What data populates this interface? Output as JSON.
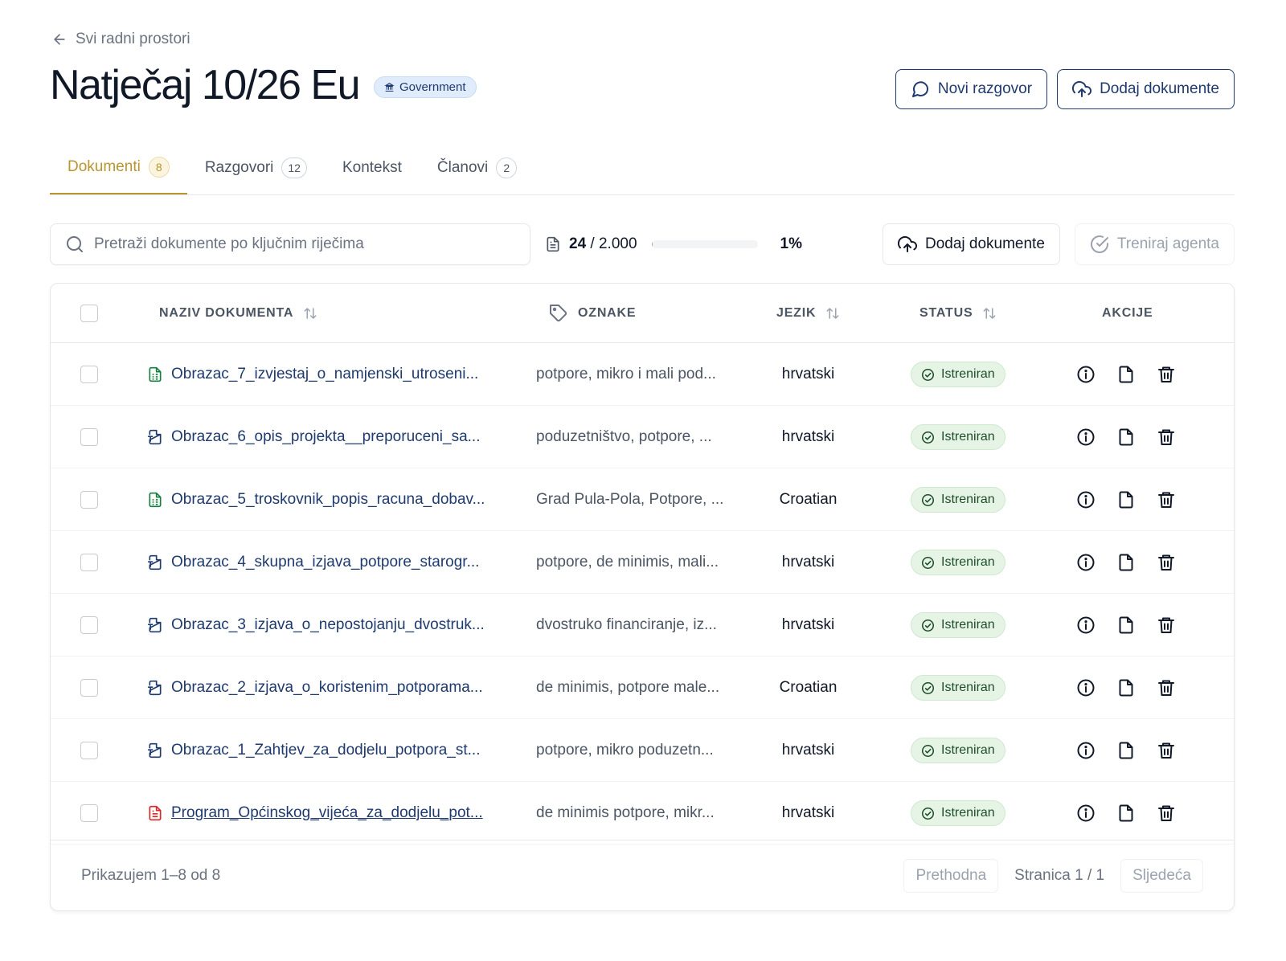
{
  "back_link": "Svi radni prostori",
  "title": "Natječaj 10/26 Eu",
  "category_badge": "Government",
  "header_buttons": {
    "new_chat": "Novi razgovor",
    "add_docs": "Dodaj dokumente"
  },
  "tabs": [
    {
      "label": "Dokumenti",
      "count": "8",
      "active": true
    },
    {
      "label": "Razgovori",
      "count": "12"
    },
    {
      "label": "Kontekst",
      "count": null
    },
    {
      "label": "Članovi",
      "count": "2"
    }
  ],
  "search": {
    "placeholder": "Pretraži dokumente po ključnim riječima"
  },
  "quota": {
    "used": "24",
    "limit": "2.000",
    "percent": "1%",
    "fill_fraction": 0.012
  },
  "toolbar": {
    "add_docs": "Dodaj dokumente",
    "train_agent": "Treniraj agenta"
  },
  "table": {
    "columns": {
      "name": "NAZIV DOKUMENTA",
      "tags": "OZNAKE",
      "language": "JEZIK",
      "status": "STATUS",
      "actions": "AKCIJE"
    },
    "rows": [
      {
        "name": "Obrazac_7_izvjestaj_o_namjenski_utroseni...",
        "type": "sheet",
        "tags": "potpore, mikro i mali pod...",
        "language": "hrvatski",
        "status": "Istreniran"
      },
      {
        "name": "Obrazac_6_opis_projekta__preporuceni_sa...",
        "type": "doc",
        "tags": "poduzetništvo, potpore, ...",
        "language": "hrvatski",
        "status": "Istreniran"
      },
      {
        "name": "Obrazac_5_troskovnik_popis_racuna_dobav...",
        "type": "sheet",
        "tags": "Grad Pula-Pola, Potpore, ...",
        "language": "Croatian",
        "status": "Istreniran"
      },
      {
        "name": "Obrazac_4_skupna_izjava_potpore_starogr...",
        "type": "doc",
        "tags": "potpore, de minimis, mali...",
        "language": "hrvatski",
        "status": "Istreniran"
      },
      {
        "name": "Obrazac_3_izjava_o_nepostojanju_dvostruk...",
        "type": "doc",
        "tags": "dvostruko financiranje, iz...",
        "language": "hrvatski",
        "status": "Istreniran"
      },
      {
        "name": "Obrazac_2_izjava_o_koristenim_potporama...",
        "type": "doc",
        "tags": "de minimis, potpore male...",
        "language": "Croatian",
        "status": "Istreniran"
      },
      {
        "name": "Obrazac_1_Zahtjev_za_dodjelu_potpora_st...",
        "type": "doc",
        "tags": "potpore, mikro poduzetn...",
        "language": "hrvatski",
        "status": "Istreniran"
      },
      {
        "name": "Program_Općinskog_vijeća_za_dodjelu_pot...",
        "type": "pdf",
        "tags": "de minimis potpore, mikr...",
        "language": "hrvatski",
        "status": "Istreniran"
      }
    ]
  },
  "footer": {
    "showing": "Prikazujem 1–8 od 8",
    "prev": "Prethodna",
    "page_info": "Stranica 1 / 1",
    "next": "Sljedeća"
  },
  "colors": {
    "accent_gold": "#b8952f",
    "navy": "#1e3a6e",
    "status_green_bg": "#e6f4e6",
    "pdf_red": "#dc2626",
    "sheet_green": "#15803d"
  }
}
